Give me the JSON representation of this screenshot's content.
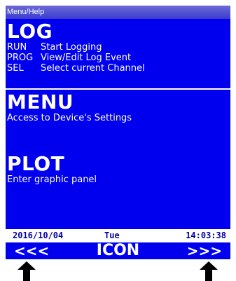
{
  "titlebar": {
    "label": "Menu/Help"
  },
  "log": {
    "title": "LOG",
    "rows": [
      {
        "key": "RUN",
        "desc": "Start Logging"
      },
      {
        "key": "PROG",
        "desc": "View/Edit Log Event"
      },
      {
        "key": "SEL",
        "desc": "Select current Channel"
      }
    ]
  },
  "menu": {
    "title": "MENU",
    "desc": "Access to Device's Settings"
  },
  "plot": {
    "title": "PLOT",
    "desc": "Enter graphic panel"
  },
  "status": {
    "date": "2016/10/04",
    "day": "Tue",
    "time": "14:03:38"
  },
  "nav": {
    "left": "<<<",
    "center": "ICON",
    "right": ">>>"
  },
  "icons": {
    "left_arrow": "up-arrow-icon",
    "right_arrow": "up-arrow-icon"
  },
  "colors": {
    "screen_bg": "#0000ee",
    "text": "#ffffff",
    "status_bg": "#ffffff",
    "status_text": "#0000aa"
  }
}
